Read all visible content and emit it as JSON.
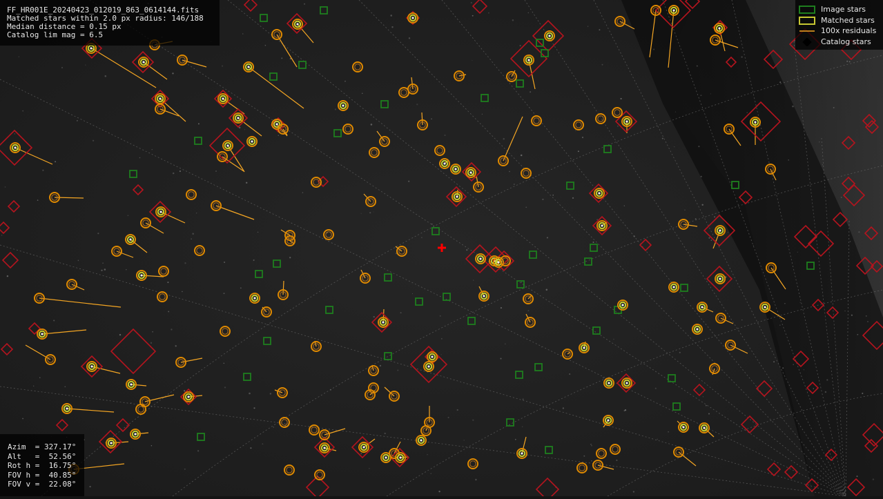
{
  "header": {
    "filename": "FF_HR001E_20240423_012019_863_0614144.fits",
    "matched_line": "Matched stars within 2.0 px radius: 146/188",
    "median_line": "Median distance = 0.15 px",
    "limmag_line": "Catalog lim mag = 6.5"
  },
  "legend": {
    "items": [
      {
        "label": "Image stars",
        "icon": "green-square",
        "color": "#1e7e1e"
      },
      {
        "label": "Matched stars",
        "icon": "yellow-square",
        "color": "#c8c832"
      },
      {
        "label": "100x residuals",
        "icon": "orange-line",
        "color": "#f5a623"
      },
      {
        "label": "Catalog stars",
        "icon": "red-diamond",
        "color": "#b4141e"
      }
    ]
  },
  "pointing": {
    "azim": "Azim  = 327.17°",
    "alt": "Alt   =  52.56°",
    "rot": "Rot h =  16.75°",
    "fovh": "FOV h =  40.85°",
    "fovv": "FOV v =  22.08°"
  },
  "colors": {
    "image_star": "#1e7e1e",
    "matched_outer": "#e08a00",
    "matched_inner": "#c8d232",
    "residual": "#f5a623",
    "catalog": "#b4141e",
    "center_marker": "#ff0000",
    "grid": "#6a6a6a"
  },
  "icons": {
    "center": "red-cross-icon"
  }
}
